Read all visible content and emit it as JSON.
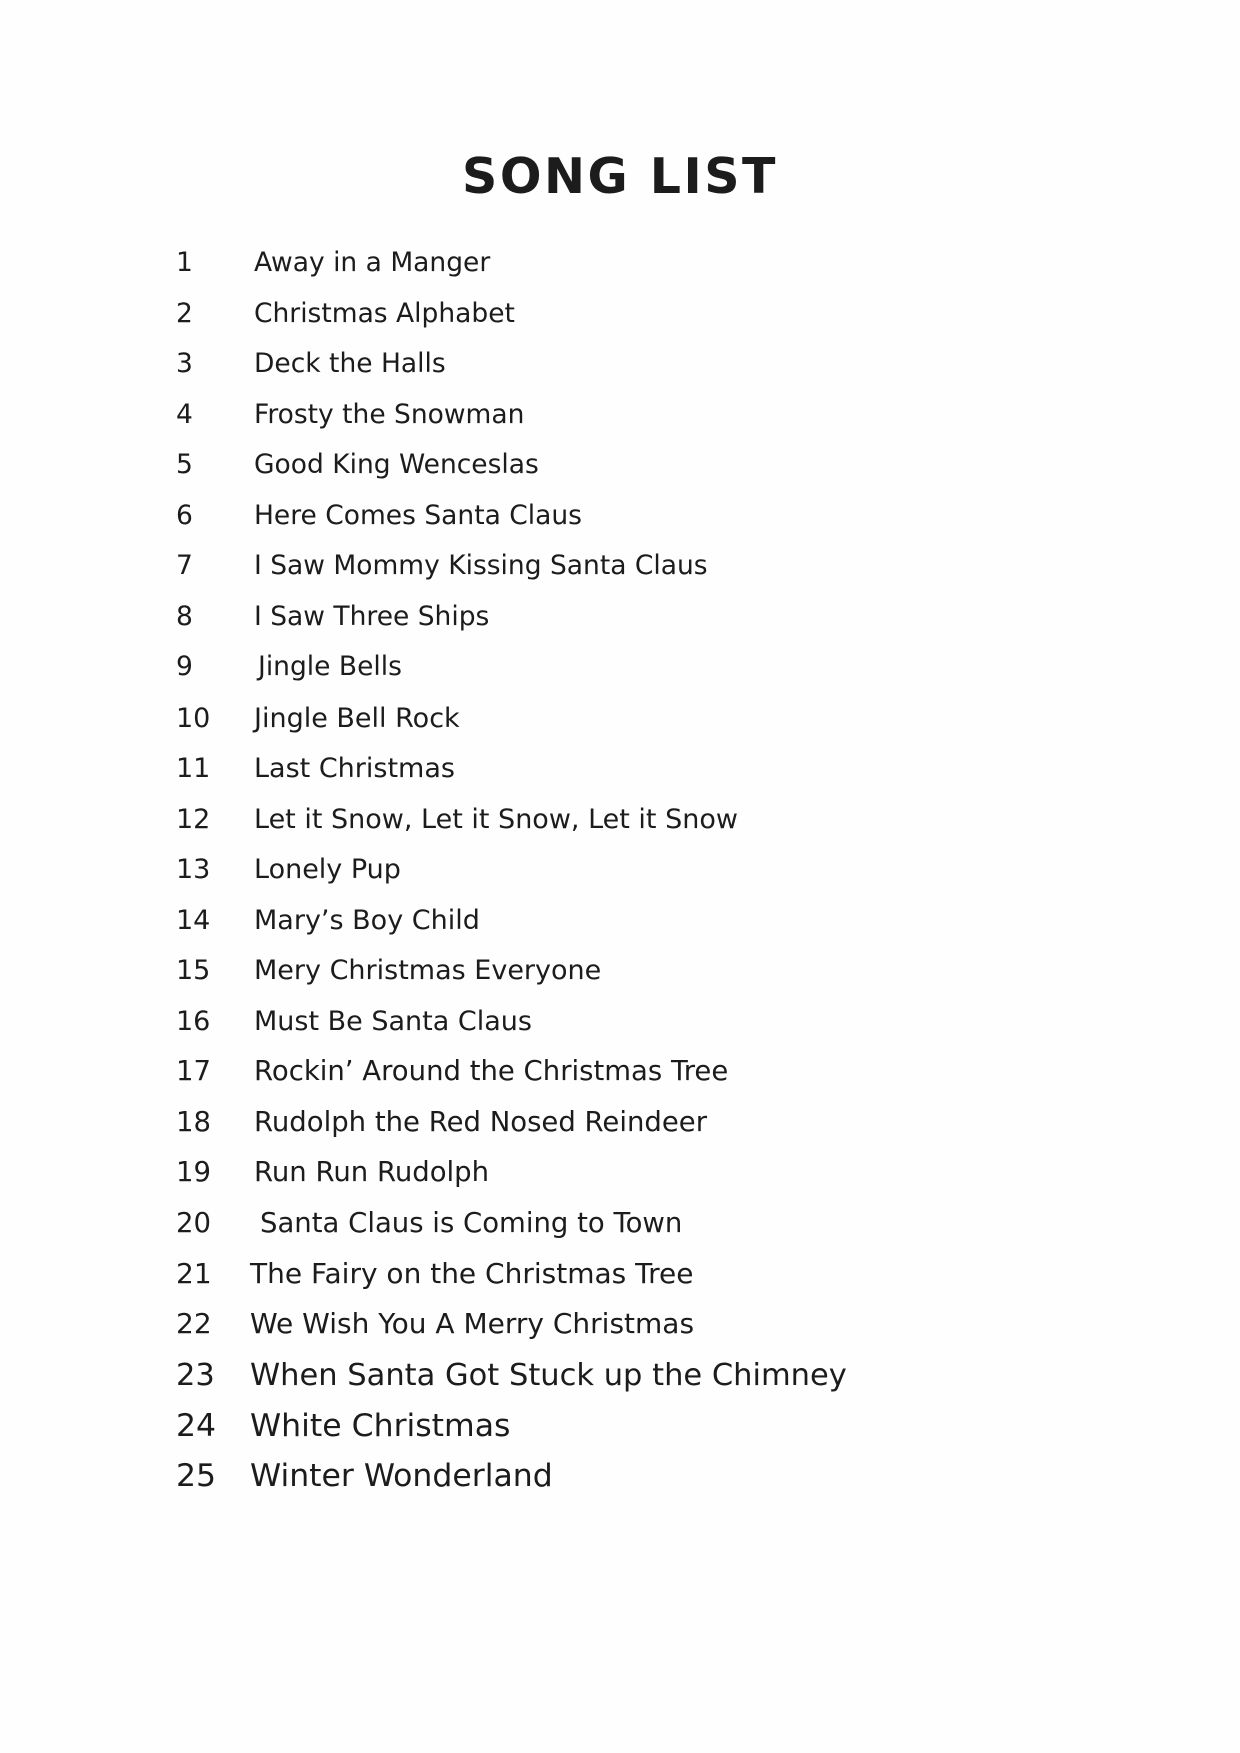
{
  "document": {
    "title": "SONG LIST",
    "background_color": "#fefefe",
    "text_color": "#1c1c1c"
  },
  "songs": [
    {
      "number": "1",
      "title": "Away in a Manger"
    },
    {
      "number": "2",
      "title": "Christmas Alphabet"
    },
    {
      "number": "3",
      "title": "Deck the Halls"
    },
    {
      "number": "4",
      "title": "Frosty the Snowman"
    },
    {
      "number": "5",
      "title": "Good King Wenceslas"
    },
    {
      "number": "6",
      "title": "Here Comes Santa Claus"
    },
    {
      "number": "7",
      "title": "I Saw Mommy Kissing Santa Claus"
    },
    {
      "number": "8",
      "title": "I Saw Three Ships"
    },
    {
      "number": "9",
      "title": "Jingle Bells"
    },
    {
      "number": "10",
      "title": "Jingle Bell Rock"
    },
    {
      "number": "11",
      "title": "Last Christmas"
    },
    {
      "number": "12",
      "title": "Let it Snow, Let it Snow, Let it Snow"
    },
    {
      "number": "13",
      "title": "Lonely Pup"
    },
    {
      "number": "14",
      "title": "Mary’s Boy Child"
    },
    {
      "number": "15",
      "title": "Mery Christmas Everyone"
    },
    {
      "number": "16",
      "title": "Must Be Santa Claus"
    },
    {
      "number": "17",
      "title": "Rockin’ Around the Christmas Tree"
    },
    {
      "number": "18",
      "title": "Rudolph the Red Nosed Reindeer"
    },
    {
      "number": "19",
      "title": "Run Run Rudolph"
    },
    {
      "number": "20",
      "title": "Santa Claus is Coming to Town"
    },
    {
      "number": "21",
      "title": "The Fairy on the Christmas Tree"
    },
    {
      "number": "22",
      "title": "We Wish You A Merry Christmas"
    },
    {
      "number": "23",
      "title": "When Santa Got Stuck up the Chimney"
    },
    {
      "number": "24",
      "title": "White Christmas"
    },
    {
      "number": "25",
      "title": "Winter Wonderland"
    }
  ]
}
